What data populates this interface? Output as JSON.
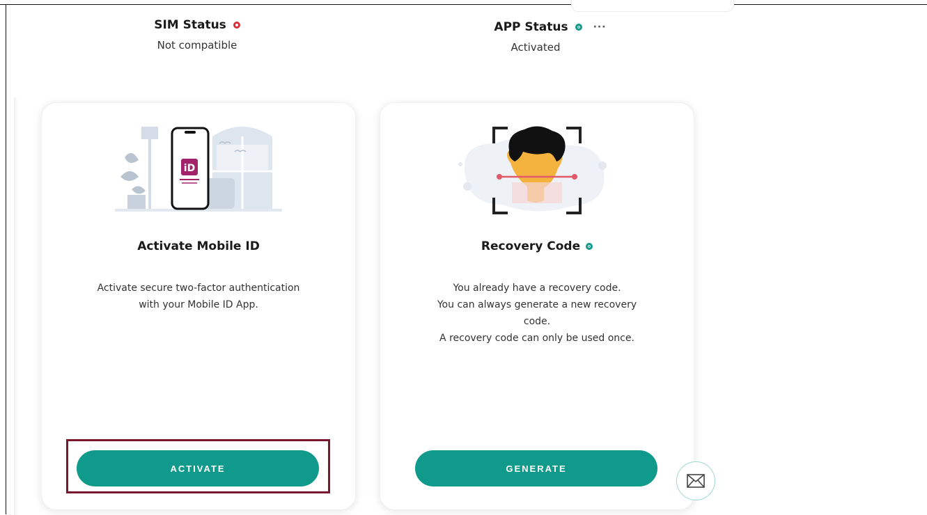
{
  "sim_status": {
    "title": "SIM Status",
    "value": "Not compatible",
    "indicator_color": "#d9313a"
  },
  "app_status": {
    "title": "APP Status",
    "value": "Activated",
    "indicator_color": "#0f9a8c",
    "more_label": "···"
  },
  "cards": [
    {
      "title": "Activate Mobile ID",
      "description_lines": [
        "Activate secure two-factor authentication",
        "with your Mobile ID App."
      ],
      "button_label": "ACTIVATE",
      "illustration": "phone-with-mobile-id-app-icon"
    },
    {
      "title": "Recovery Code",
      "title_badge_color": "#0f9a8c",
      "description_lines": [
        "You already have a recovery code.",
        "You can always generate a new recovery",
        "code.",
        "A recovery code can only be used once."
      ],
      "button_label": "GENERATE",
      "illustration": "face-scan-icon"
    }
  ],
  "floating": {
    "icon": "mail-icon"
  },
  "colors": {
    "accent": "#0f9a8c",
    "highlight": "#7a1730",
    "error": "#d9313a"
  }
}
